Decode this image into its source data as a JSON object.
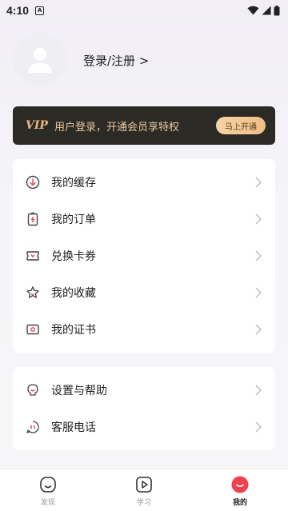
{
  "status": {
    "time": "4:10",
    "badge": "A"
  },
  "profile": {
    "login_label": "登录/注册 >"
  },
  "vip": {
    "tag": "VIP",
    "text": "用户登录，开通会员享特权",
    "button": "马上开通"
  },
  "menu_group_1": [
    {
      "label": "我的缓存",
      "icon": "download-icon"
    },
    {
      "label": "我的订单",
      "icon": "order-icon"
    },
    {
      "label": "兑换卡券",
      "icon": "ticket-icon"
    },
    {
      "label": "我的收藏",
      "icon": "star-icon"
    },
    {
      "label": "我的证书",
      "icon": "certificate-icon"
    }
  ],
  "menu_group_2": [
    {
      "label": "设置与帮助",
      "icon": "settings-help-icon"
    },
    {
      "label": "客服电话",
      "icon": "customer-service-icon"
    }
  ],
  "tabs": [
    {
      "label": "发现",
      "icon": "discover-icon",
      "active": false
    },
    {
      "label": "学习",
      "icon": "play-icon",
      "active": false
    },
    {
      "label": "我的",
      "icon": "profile-face-icon",
      "active": true
    }
  ],
  "colors": {
    "accent": "#f0424e",
    "vip_bg": "#2b2a25",
    "vip_gold": "#e9b980"
  }
}
